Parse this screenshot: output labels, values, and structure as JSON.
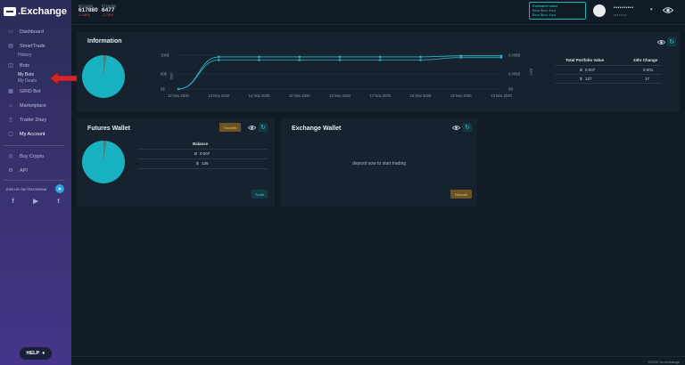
{
  "brand": {
    "name": ".Exchange"
  },
  "sidebar": {
    "items": [
      {
        "label": "Dashboard",
        "icon": "dashboard-icon"
      },
      {
        "label": "SmartTrade",
        "icon": "smarttrade-icon"
      },
      {
        "label": "Bots",
        "icon": "bots-icon"
      },
      {
        "label": "GRID Bot",
        "icon": "grid-icon"
      },
      {
        "label": "Marketplace",
        "icon": "marketplace-icon"
      },
      {
        "label": "Trader Diary",
        "icon": "diary-icon"
      },
      {
        "label": "My Account",
        "icon": "account-icon"
      },
      {
        "label": "Buy Crypto",
        "icon": "buy-crypto-icon"
      },
      {
        "label": "API",
        "icon": "api-icon"
      }
    ],
    "sub_history": "History",
    "sub_my_bots": "My Bots",
    "sub_my_deals": "My Deals",
    "telegram": "JOIN US ON TELEGRAM",
    "help": "HELP"
  },
  "header": {
    "tickers": [
      {
        "pair": "BTCUSD",
        "value": "617880",
        "change": "-0.48%"
      },
      {
        "pair": "ETHUSD",
        "value": "6477",
        "change": "-2.75%"
      }
    ],
    "estimated": {
      "label": "Estimated value",
      "line1": "B•••• $•••• 1••••",
      "line2": "B•••• $•••• 1••••"
    },
    "user_name": "••••••••••",
    "user_sub": "••••••••"
  },
  "information": {
    "title": "Information",
    "y_left_ticks": [
      "100$",
      "80$",
      "0$"
    ],
    "y_left_label": "USD",
    "y_right_ticks": [
      "0.008B",
      "0.006B",
      "0B"
    ],
    "y_right_label": "BTC",
    "x_ticks": [
      "12 Nov 2020",
      "13 Nov 2020",
      "14 Nov 2020",
      "15 Nov 2020",
      "16 Nov 2020",
      "17 Nov 2020",
      "18 Nov 2020",
      "19 Nov 2020",
      "13 Nov 2020"
    ],
    "table": {
      "col1": "Total Portfolio Value",
      "col2": "24hr Change",
      "row1": {
        "icon": "bitcoin-icon",
        "sym": "B",
        "v1": "0.007",
        "v2": "0.001"
      },
      "row2": {
        "icon": "dollar-icon",
        "sym": "$",
        "v1": "127",
        "v2": "17"
      }
    }
  },
  "futures": {
    "title": "Futures Wallet",
    "transfer": "Transfer",
    "balance_header": "Balance",
    "btc": {
      "sym": "B",
      "value": "0.007"
    },
    "usd": {
      "sym": "$",
      "value": "126"
    },
    "trade": "Trade"
  },
  "exchange": {
    "title": "Exchange Wallet",
    "message": "deposit now to start trading",
    "deposit": "Deposit"
  },
  "footer": {
    "copyright": "©2020 3c.exchange"
  },
  "chart_data": {
    "type": "line",
    "x": [
      "12 Nov 2020",
      "13 Nov 2020",
      "14 Nov 2020",
      "15 Nov 2020",
      "16 Nov 2020",
      "17 Nov 2020",
      "18 Nov 2020",
      "19 Nov 2020",
      "13 Nov 2020"
    ],
    "series": [
      {
        "values": [
          0,
          95,
          95,
          95,
          95,
          95,
          95,
          98,
          98
        ]
      },
      {
        "values": [
          0,
          86,
          86,
          86,
          86,
          86,
          86,
          93,
          93
        ]
      }
    ],
    "colors": [
      "#2fb6c9",
      "#27a8b9"
    ],
    "ylim": [
      0,
      100
    ],
    "y_right_ticks": [
      "0.008B",
      "0.006B",
      "0B"
    ],
    "grid": true
  }
}
